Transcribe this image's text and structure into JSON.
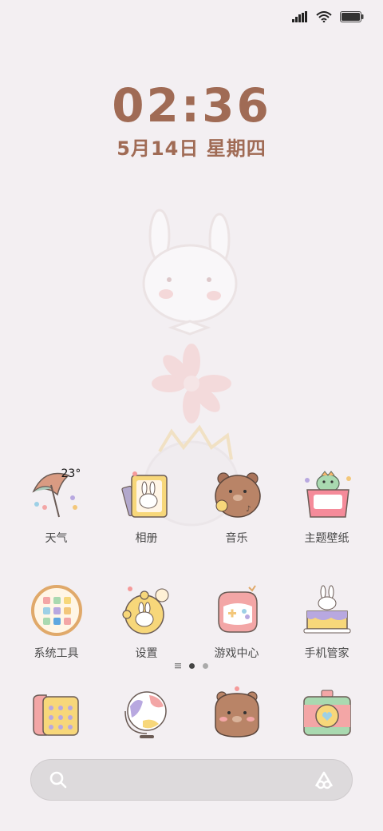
{
  "status_bar": {
    "signal": "signal-icon",
    "wifi": "wifi-icon",
    "battery": "battery-icon"
  },
  "clock": {
    "time": "02:36",
    "date": "5月14日 星期四"
  },
  "weather": {
    "temp": "23°"
  },
  "apps": [
    {
      "label": "天气",
      "icon": "weather-umbrella-icon"
    },
    {
      "label": "相册",
      "icon": "gallery-bunny-icon"
    },
    {
      "label": "音乐",
      "icon": "music-bear-icon"
    },
    {
      "label": "主题壁纸",
      "icon": "theme-dino-icon"
    },
    {
      "label": "系统工具",
      "icon": "system-tools-icon"
    },
    {
      "label": "设置",
      "icon": "settings-bunny-icon"
    },
    {
      "label": "游戏中心",
      "icon": "game-controller-icon"
    },
    {
      "label": "手机管家",
      "icon": "phone-manager-cake-icon"
    }
  ],
  "dock": [
    {
      "icon": "phone-dialer-icon"
    },
    {
      "icon": "browser-globe-icon"
    },
    {
      "icon": "messages-bear-icon"
    },
    {
      "icon": "camera-icon"
    }
  ],
  "pages": {
    "count": 2,
    "active": 0
  },
  "search": {
    "icon": "search-icon",
    "assistant_icon": "assistant-icon"
  },
  "colors": {
    "accent": "#a06b55",
    "background": "#f3eff2"
  }
}
